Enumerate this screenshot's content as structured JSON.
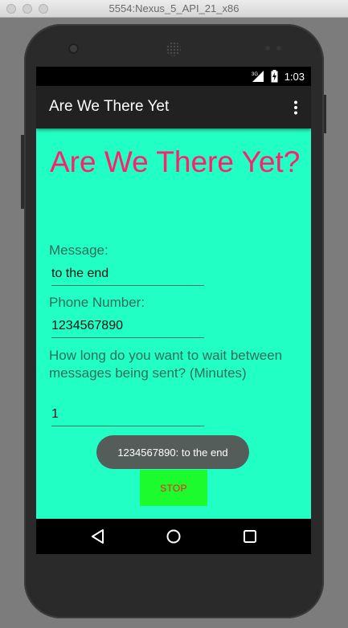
{
  "window": {
    "title": "5554:Nexus_5_API_21_x86"
  },
  "statusbar": {
    "time": "1:03",
    "signal_icon": "signal-3g-icon",
    "battery_icon": "battery-charging-icon"
  },
  "appbar": {
    "title": "Are We There Yet",
    "menu_icon": "overflow-menu-icon"
  },
  "main": {
    "heading": "Are We There Yet?",
    "message_label": "Message:",
    "message_value": "to the end",
    "phone_label": "Phone Number:",
    "phone_value": "1234567890",
    "interval_label": "How long do you want to wait between messages being sent? (Minutes)",
    "interval_value": "1",
    "stop_label": "STOP"
  },
  "toast": {
    "text": "1234567890: to the end"
  },
  "colors": {
    "content_bg": "#22ffc4",
    "heading": "#ff1f6a",
    "stop_bg": "#1cfb2e",
    "stop_text": "#ff1a1a"
  }
}
